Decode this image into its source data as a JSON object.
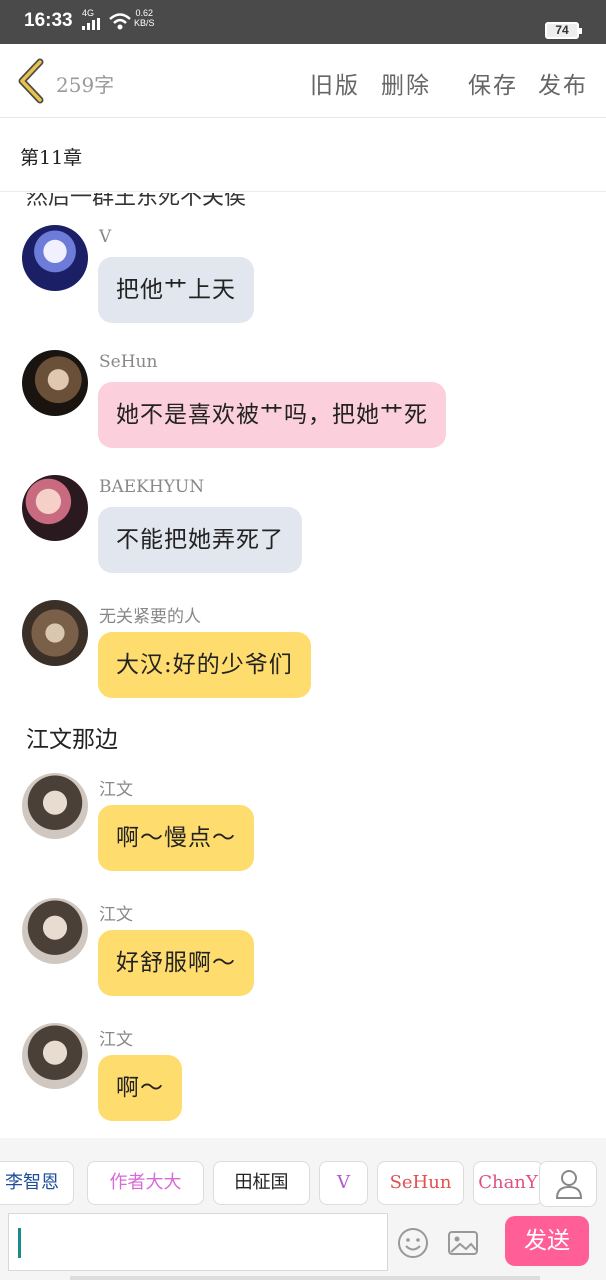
{
  "status": {
    "time": "16:33",
    "network": "4G",
    "speed_value": "0.62",
    "speed_unit": "KB/S",
    "battery": "74"
  },
  "topbar": {
    "word_count": "259字",
    "old_version": "旧版",
    "delete": "删除",
    "save": "保存",
    "publish": "发布"
  },
  "chapter": {
    "title": "第11章"
  },
  "chat": {
    "cut_text": "然后一群王东死不关侯",
    "messages": [
      {
        "name": "V",
        "text": "把他艹上天",
        "bubble": "gray"
      },
      {
        "name": "SeHun",
        "text": "她不是喜欢被艹吗，把她艹死",
        "bubble": "pink"
      },
      {
        "name": "BAEKHYUN",
        "text": "不能把她弄死了",
        "bubble": "gray"
      },
      {
        "name": "无关紧要的人",
        "text": "大汉:好的少爷们",
        "bubble": "yellow"
      }
    ],
    "narration": "江文那边",
    "messages2": [
      {
        "name": "江文",
        "text": "啊～慢点～",
        "bubble": "yellow"
      },
      {
        "name": "江文",
        "text": "好舒服啊～",
        "bubble": "yellow"
      },
      {
        "name": "江文",
        "text": "啊～",
        "bubble": "yellow"
      }
    ]
  },
  "characters": [
    "李智恩",
    "作者大大",
    "田柾国",
    "V",
    "SeHun",
    "ChanY"
  ],
  "character_colors": [
    "#1d4e9a",
    "#d86ad8",
    "#222222",
    "#b05ad0",
    "#e05050",
    "#e05080"
  ],
  "input": {
    "placeholder": ""
  },
  "send_label": "发送",
  "colors": {
    "accent": "#ff5f96",
    "bubble_gray": "#e2e6ee",
    "bubble_pink": "#fbd0dc",
    "bubble_yellow": "#ffdc6e",
    "back_arrow": "#e8c24a"
  }
}
